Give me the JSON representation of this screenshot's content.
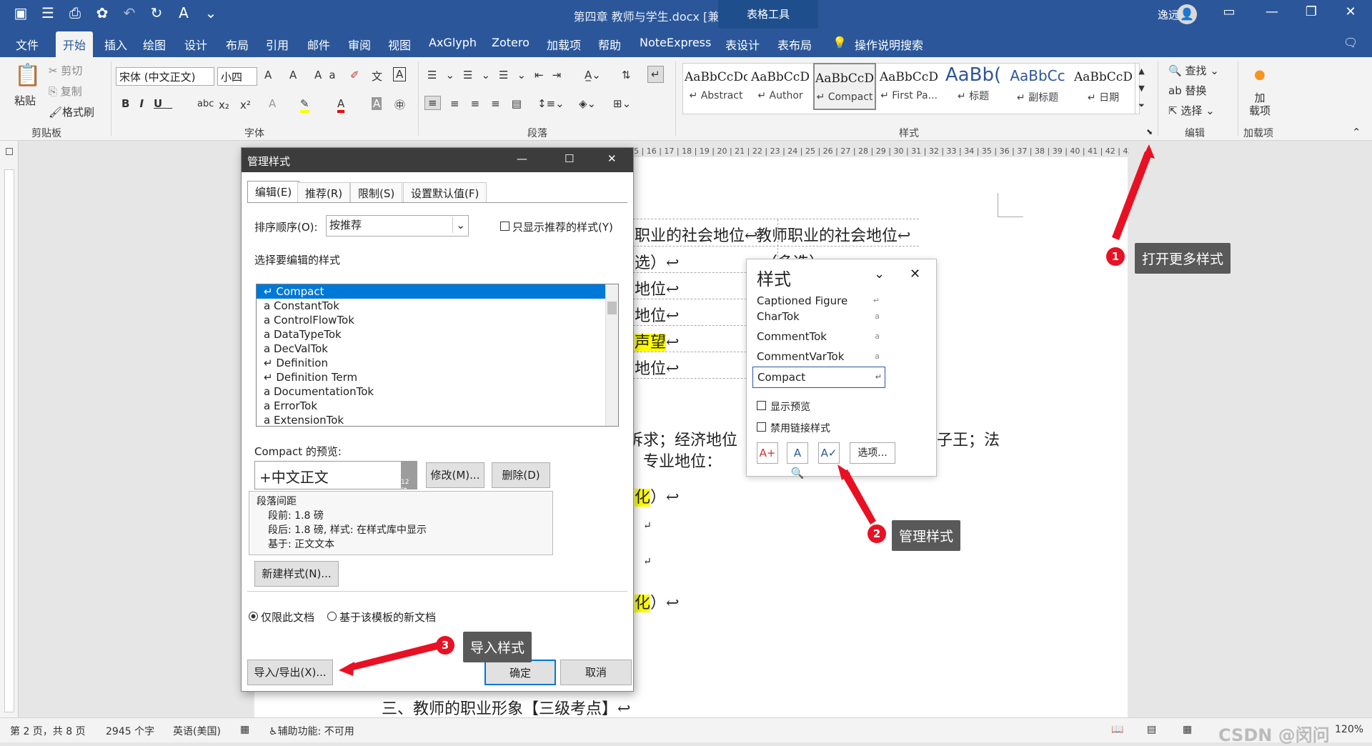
{
  "window": {
    "title": "第四章 教师与学生.docx [兼容模式] - Word",
    "table_tools": "表格工具",
    "user": "逸远 秦",
    "avatar": "person-icon"
  },
  "menu": {
    "tabs": [
      "文件",
      "开始",
      "插入",
      "绘图",
      "设计",
      "布局",
      "引用",
      "邮件",
      "审阅",
      "视图",
      "AxGlyph",
      "Zotero",
      "加载项",
      "帮助",
      "NoteExpress",
      "表设计",
      "表布局"
    ],
    "active": "开始",
    "search": "操作说明搜索"
  },
  "ribbon": {
    "clipboard": {
      "paste": "粘贴",
      "cut": "剪切",
      "copy": "复制",
      "format_painter": "格式刷",
      "label": "剪贴板"
    },
    "font": {
      "name": "宋体 (中文正文)",
      "size": "小四",
      "label": "字体"
    },
    "paragraph": {
      "label": "段落"
    },
    "styles": {
      "label": "样式",
      "items": [
        {
          "sample": "AaBbCcDd",
          "name": "Abstract"
        },
        {
          "sample": "AaBbCcD",
          "name": "Author"
        },
        {
          "sample": "AaBbCcD",
          "name": "Compact"
        },
        {
          "sample": "AaBbCcD",
          "name": "First Pa..."
        },
        {
          "sample": "AaBb(",
          "name": "标题"
        },
        {
          "sample": "AaBbCc",
          "name": "副标题"
        },
        {
          "sample": "AaBbCcD",
          "name": "日期"
        }
      ]
    },
    "editing": {
      "find": "查找",
      "replace": "替换",
      "select": "选择",
      "label": "编辑"
    },
    "addins": {
      "load": "加\n载项",
      "label": "加载项"
    }
  },
  "ruler": "15 | 16 | 17 | 18 | 19 | 20 | 21 | 22 | 23 | 24 | 25 | 26 | 27 | 28 | 29 | 30 | 31 | 32 | 33 | 34 | 35 | 36 | 37 | 38 | 39 | 40 | 41 | 42 | 43",
  "document": {
    "cell1": "职业的社会地位↩",
    "cell2": "教师职业的社会地位↩",
    "row2a": "选）↩",
    "row2b": "（多选）↩",
    "row3": "地位↩",
    "row4": "地位↩",
    "row5": "声望",
    "row5end": "↩",
    "row6": "地位↩",
    "para1": "求诉求；经济地位",
    "para1b": "子王；法",
    "para2": "位；专业地位：",
    "hl1": "化",
    "tail": "）↩",
    "heading": "三、教师的职业形象【三级考点】↩"
  },
  "dialog": {
    "title": "管理样式",
    "tabs": [
      "编辑(E)",
      "推荐(R)",
      "限制(S)",
      "设置默认值(F)"
    ],
    "sort_label": "排序顺序(O):",
    "sort_value": "按推荐",
    "only_recommended": "只显示推荐的样式(Y)",
    "select_label": "选择要编辑的样式",
    "styles": [
      {
        "mark": "↵",
        "name": "Compact"
      },
      {
        "mark": "a",
        "name": "ConstantTok"
      },
      {
        "mark": "a",
        "name": "ControlFlowTok"
      },
      {
        "mark": "a",
        "name": "DataTypeTok"
      },
      {
        "mark": "a",
        "name": "DecValTok"
      },
      {
        "mark": "↵",
        "name": "Definition"
      },
      {
        "mark": "↵",
        "name": "Definition Term"
      },
      {
        "mark": "a",
        "name": "DocumentationTok"
      },
      {
        "mark": "a",
        "name": "ErrorTok"
      },
      {
        "mark": "a",
        "name": "ExtensionTok"
      }
    ],
    "preview_label": "Compact 的预览:",
    "preview_text": "+中文正文",
    "preview_size": "12 磅",
    "modify": "修改(M)...",
    "delete": "删除(D)",
    "desc": [
      "段落间距",
      "段前: 1.8 磅",
      "段后: 1.8 磅, 样式: 在样式库中显示",
      "基于: 正文文本"
    ],
    "new_style": "新建样式(N)...",
    "radio1": "仅限此文档",
    "radio2": "基于该模板的新文档",
    "import_export": "导入/导出(X)...",
    "ok": "确定",
    "cancel": "取消"
  },
  "styles_pane": {
    "title": "样式",
    "items": [
      {
        "name": "Captioned Figure",
        "mark": "↵"
      },
      {
        "name": "CharTok",
        "mark": "a"
      },
      {
        "name": "CommentTok",
        "mark": "a"
      },
      {
        "name": "CommentVarTok",
        "mark": "a"
      },
      {
        "name": "Compact",
        "mark": "↵"
      }
    ],
    "show_preview": "显示预览",
    "disable_linked": "禁用链接样式",
    "options": "选项..."
  },
  "callouts": [
    {
      "num": "1",
      "text": "打开更多样式"
    },
    {
      "num": "2",
      "text": "管理样式"
    },
    {
      "num": "3",
      "text": "导入样式"
    }
  ],
  "status": {
    "page": "第 2 页，共 8 页",
    "words": "2945 个字",
    "lang": "英语(美国)",
    "accessibility": "辅助功能: 不可用",
    "zoom": "120%",
    "watermark": "CSDN @闵问"
  }
}
